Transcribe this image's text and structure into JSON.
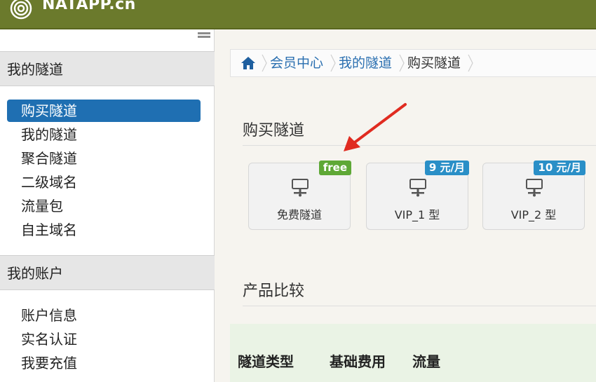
{
  "brand": {
    "logo_text": "NATAPP.cn"
  },
  "sidebar": {
    "section1_title": "我的隧道",
    "section1_items": [
      "购买隧道",
      "我的隧道",
      "聚合隧道",
      "二级域名",
      "流量包",
      "自主域名"
    ],
    "section2_title": "我的账户",
    "section2_items": [
      "账户信息",
      "实名认证",
      "我要充值"
    ],
    "active_item": "购买隧道"
  },
  "breadcrumb": {
    "items": [
      "会员中心",
      "我的隧道",
      "购买隧道"
    ]
  },
  "purchase": {
    "title": "购买隧道",
    "cards": [
      {
        "label": "免费隧道",
        "badge": "free",
        "badge_color": "#5ea836"
      },
      {
        "label": "VIP_1 型",
        "badge": "9 元/月",
        "badge_color": "#2a8fc7"
      },
      {
        "label": "VIP_2 型",
        "badge": "10 元/月",
        "badge_color": "#2a8fc7"
      }
    ]
  },
  "compare": {
    "title": "产品比较",
    "headers": [
      "隧道类型",
      "基础费用",
      "流量"
    ]
  },
  "colors": {
    "topbar": "#6b7a2c",
    "active": "#1f6fb2",
    "link": "#2a6fb0",
    "arrow": "#e02b20"
  }
}
